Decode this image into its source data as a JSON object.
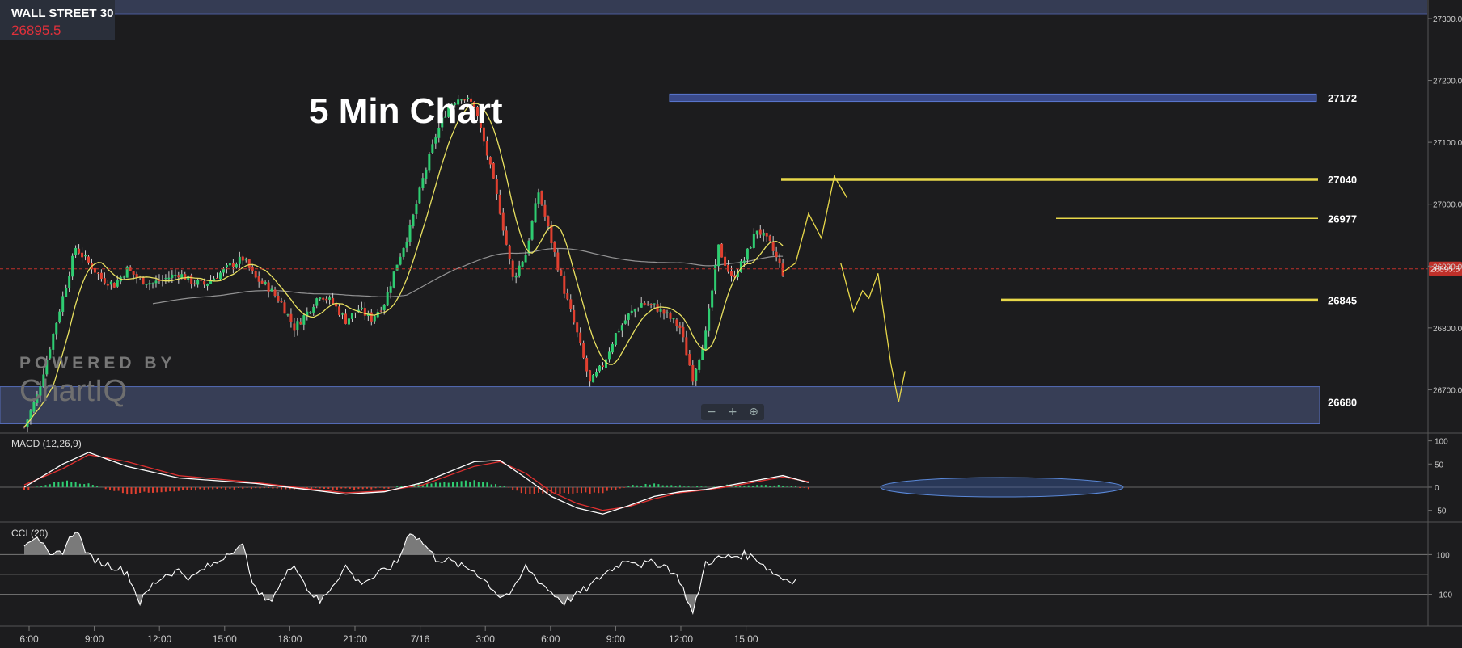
{
  "instrument": {
    "name": "WALL STREET 30",
    "price": "26895.5"
  },
  "annotation_title": "5 Min Chart",
  "watermark": {
    "line1": "POWERED BY",
    "line2": "ChartIQ"
  },
  "zoom_controls": {
    "zoom_out": "−",
    "zoom_in": "+",
    "reset": "⊕"
  },
  "colors": {
    "up": "#2ecc71",
    "down": "#e04030",
    "level": "#e8d84a",
    "ma_fast": "#e8e060",
    "ma_slow": "#b0b0b0",
    "zone": "#39405a",
    "price_tag": "#c0302a"
  },
  "chart_data": [
    {
      "type": "candlestick",
      "title": "",
      "x_ticks": [
        "6:00",
        "9:00",
        "12:00",
        "15:00",
        "18:00",
        "21:00",
        "7/16",
        "3:00",
        "6:00",
        "9:00",
        "12:00",
        "15:00"
      ],
      "y_ticks": [
        "27300.0",
        "27200.0",
        "27100.0",
        "27000.0",
        "26900.0",
        "26800.0",
        "26700.0"
      ],
      "ylim": [
        26630,
        27330
      ],
      "current_price": "26895.5",
      "levels": [
        {
          "label": "27172",
          "value": 27172
        },
        {
          "label": "27040",
          "value": 27040
        },
        {
          "label": "26977",
          "value": 26977
        },
        {
          "label": "26845",
          "value": 26845
        },
        {
          "label": "26680",
          "value": 26680
        }
      ],
      "price_path": [
        [
          0,
          26640
        ],
        [
          1,
          26690
        ],
        [
          2,
          26770
        ],
        [
          3,
          26850
        ],
        [
          4,
          26930
        ],
        [
          5,
          26905
        ],
        [
          6,
          26880
        ],
        [
          7,
          26870
        ],
        [
          8,
          26895
        ],
        [
          9,
          26878
        ],
        [
          10,
          26872
        ],
        [
          11,
          26880
        ],
        [
          12,
          26888
        ],
        [
          13,
          26875
        ],
        [
          14,
          26870
        ],
        [
          15,
          26885
        ],
        [
          16,
          26900
        ],
        [
          17,
          26912
        ],
        [
          18,
          26880
        ],
        [
          19,
          26865
        ],
        [
          20,
          26840
        ],
        [
          21,
          26800
        ],
        [
          22,
          26825
        ],
        [
          23,
          26855
        ],
        [
          24,
          26840
        ],
        [
          25,
          26812
        ],
        [
          26,
          26830
        ],
        [
          27,
          26815
        ],
        [
          28,
          26840
        ],
        [
          29,
          26905
        ],
        [
          30,
          26960
        ],
        [
          31,
          27040
        ],
        [
          32,
          27110
        ],
        [
          33,
          27160
        ],
        [
          34,
          27175
        ],
        [
          35,
          27160
        ],
        [
          36,
          27080
        ],
        [
          37,
          26990
        ],
        [
          38,
          26880
        ],
        [
          39,
          26920
        ],
        [
          40,
          27020
        ],
        [
          41,
          26940
        ],
        [
          42,
          26860
        ],
        [
          43,
          26790
        ],
        [
          44,
          26710
        ],
        [
          45,
          26740
        ],
        [
          46,
          26790
        ],
        [
          47,
          26820
        ],
        [
          48,
          26840
        ],
        [
          49,
          26835
        ],
        [
          50,
          26820
        ],
        [
          51,
          26800
        ],
        [
          52,
          26720
        ],
        [
          53,
          26790
        ],
        [
          54,
          26930
        ],
        [
          55,
          26880
        ],
        [
          56,
          26910
        ],
        [
          57,
          26960
        ],
        [
          58,
          26935
        ],
        [
          59,
          26890
        ]
      ],
      "forecast_path": [
        [
          59,
          26890
        ],
        [
          60,
          26905
        ],
        [
          61,
          26985
        ],
        [
          62,
          26945
        ],
        [
          63,
          27045
        ],
        [
          64,
          27010
        ]
      ],
      "forecast_path_2": [
        [
          63.5,
          26905
        ],
        [
          64.5,
          26827
        ],
        [
          65.2,
          26860
        ],
        [
          65.7,
          26848
        ],
        [
          66.4,
          26888
        ],
        [
          67.4,
          26742
        ],
        [
          68,
          26680
        ],
        [
          68.5,
          26730
        ]
      ]
    },
    {
      "type": "line",
      "title": "MACD (12,26,9)",
      "y_ticks": [
        "100",
        "50",
        "0",
        "-50"
      ],
      "ylim": [
        -75,
        115
      ],
      "macd": [
        [
          0,
          0
        ],
        [
          3,
          50
        ],
        [
          5,
          75
        ],
        [
          8,
          45
        ],
        [
          12,
          20
        ],
        [
          18,
          8
        ],
        [
          22,
          -5
        ],
        [
          25,
          -15
        ],
        [
          28,
          -10
        ],
        [
          31,
          10
        ],
        [
          35,
          55
        ],
        [
          37,
          58
        ],
        [
          39,
          20
        ],
        [
          41,
          -20
        ],
        [
          43,
          -45
        ],
        [
          45,
          -58
        ],
        [
          47,
          -40
        ],
        [
          49,
          -20
        ],
        [
          51,
          -10
        ],
        [
          53,
          -5
        ],
        [
          55,
          5
        ],
        [
          57,
          15
        ],
        [
          59,
          25
        ],
        [
          61,
          10
        ]
      ],
      "signal": [
        [
          0,
          5
        ],
        [
          3,
          40
        ],
        [
          5,
          70
        ],
        [
          8,
          55
        ],
        [
          12,
          25
        ],
        [
          18,
          10
        ],
        [
          22,
          -3
        ],
        [
          25,
          -12
        ],
        [
          28,
          -8
        ],
        [
          31,
          5
        ],
        [
          35,
          45
        ],
        [
          37,
          55
        ],
        [
          39,
          30
        ],
        [
          41,
          -10
        ],
        [
          43,
          -35
        ],
        [
          45,
          -50
        ],
        [
          47,
          -42
        ],
        [
          49,
          -25
        ],
        [
          51,
          -12
        ],
        [
          53,
          -6
        ],
        [
          55,
          2
        ],
        [
          57,
          12
        ],
        [
          59,
          22
        ],
        [
          61,
          12
        ]
      ]
    },
    {
      "type": "area",
      "title": "CCI (20)",
      "y_ticks": [
        "100",
        "-100"
      ],
      "ylim": [
        -260,
        260
      ],
      "values": [
        [
          0,
          160
        ],
        [
          1,
          200
        ],
        [
          2,
          80
        ],
        [
          3,
          120
        ],
        [
          4,
          230
        ],
        [
          5,
          90
        ],
        [
          6,
          60
        ],
        [
          7,
          40
        ],
        [
          8,
          10
        ],
        [
          9,
          -140
        ],
        [
          10,
          -50
        ],
        [
          11,
          0
        ],
        [
          12,
          20
        ],
        [
          13,
          -20
        ],
        [
          14,
          30
        ],
        [
          15,
          60
        ],
        [
          16,
          120
        ],
        [
          17,
          140
        ],
        [
          18,
          -80
        ],
        [
          19,
          -140
        ],
        [
          20,
          -40
        ],
        [
          21,
          60
        ],
        [
          22,
          -70
        ],
        [
          23,
          -140
        ],
        [
          24,
          -50
        ],
        [
          25,
          40
        ],
        [
          26,
          -40
        ],
        [
          27,
          -20
        ],
        [
          28,
          20
        ],
        [
          29,
          60
        ],
        [
          30,
          220
        ],
        [
          31,
          160
        ],
        [
          32,
          80
        ],
        [
          33,
          70
        ],
        [
          34,
          40
        ],
        [
          35,
          20
        ],
        [
          36,
          -40
        ],
        [
          37,
          -110
        ],
        [
          38,
          -90
        ],
        [
          39,
          40
        ],
        [
          40,
          -30
        ],
        [
          41,
          -90
        ],
        [
          42,
          -140
        ],
        [
          43,
          -100
        ],
        [
          44,
          -60
        ],
        [
          45,
          0
        ],
        [
          46,
          40
        ],
        [
          47,
          80
        ],
        [
          48,
          50
        ],
        [
          49,
          60
        ],
        [
          50,
          40
        ],
        [
          51,
          -30
        ],
        [
          52,
          -200
        ],
        [
          53,
          60
        ],
        [
          54,
          80
        ],
        [
          55,
          90
        ],
        [
          56,
          100
        ],
        [
          57,
          80
        ],
        [
          58,
          20
        ],
        [
          59,
          -20
        ],
        [
          60,
          -30
        ]
      ]
    }
  ]
}
